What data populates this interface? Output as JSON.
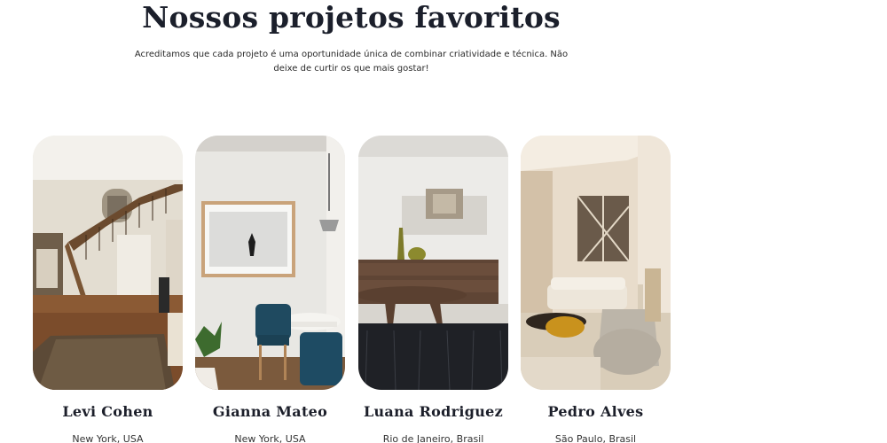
{
  "section": {
    "title": "Nossos projetos favoritos",
    "subtitle": "Acreditamos que cada projeto é uma oportunidade única de combinar criatividade e técnica. Não deixe de curtir os que mais gostar!"
  },
  "projects": [
    {
      "name": "Levi Cohen",
      "location": "New York, USA",
      "image": "staircase-hall-photo"
    },
    {
      "name": "Gianna Mateo",
      "location": "New York, USA",
      "image": "dining-corner-photo"
    },
    {
      "name": "Luana Rodriguez",
      "location": "Rio de Janeiro, Brasil",
      "image": "living-room-rug-photo"
    },
    {
      "name": "Pedro Alves",
      "location": "São Paulo, Brasil",
      "image": "double-height-living-photo"
    }
  ]
}
